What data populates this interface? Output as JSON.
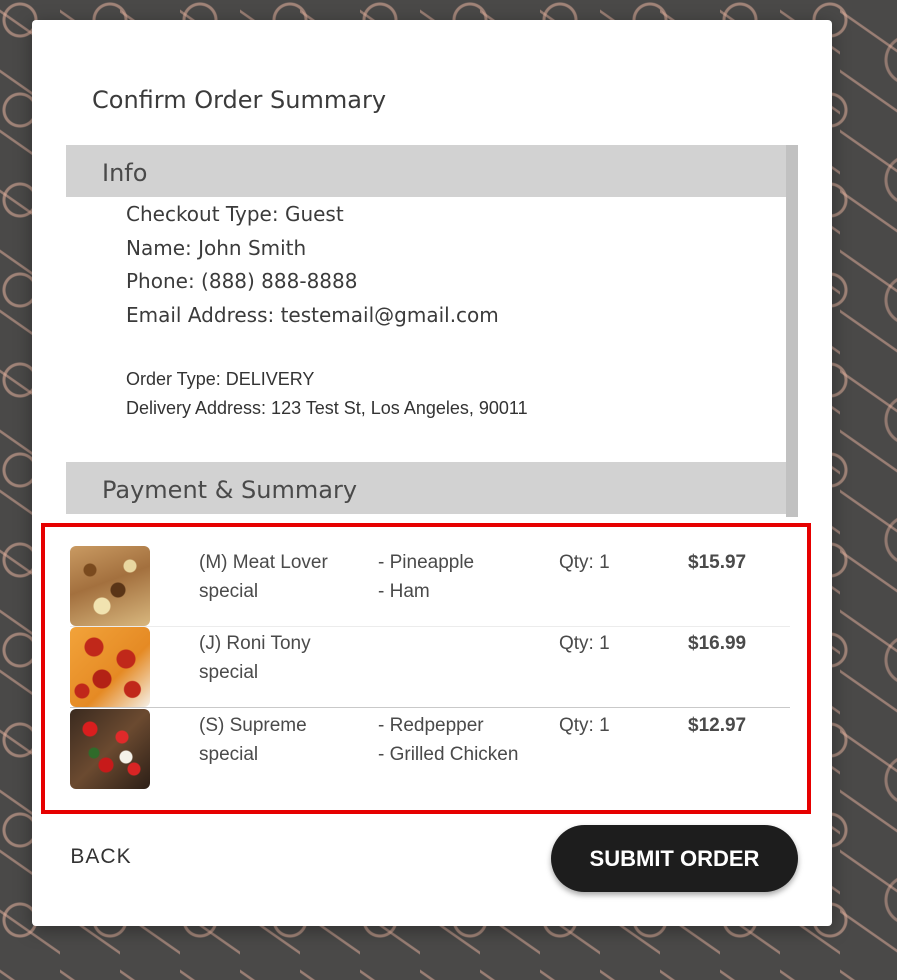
{
  "dialog": {
    "title": "Confirm Order Summary"
  },
  "info": {
    "header": "Info",
    "checkout_type": "Checkout Type: Guest",
    "name": "Name: John Smith",
    "phone": "Phone: (888) 888-8888",
    "email": "Email Address: testemail@gmail.com",
    "order_type": "Order Type: DELIVERY",
    "delivery_address": "Delivery Address: 123 Test St, Los Angeles, 90011"
  },
  "payment": {
    "header": "Payment & Summary"
  },
  "items": [
    {
      "image": "meat-lover-pizza-photo",
      "name": "(M) Meat Lover special",
      "toppings": [
        "- Pineapple",
        "- Ham"
      ],
      "qty": "Qty: 1",
      "price": "$15.97"
    },
    {
      "image": "pepperoni-pizza-photo",
      "name": "(J) Roni Tony special",
      "toppings": [],
      "qty": "Qty: 1",
      "price": "$16.99"
    },
    {
      "image": "supreme-pizza-photo",
      "name": "(S) Supreme special",
      "toppings": [
        "- Redpepper",
        "- Grilled Chicken"
      ],
      "qty": "Qty: 1",
      "price": "$12.97"
    }
  ],
  "actions": {
    "back_label": "BACK",
    "submit_label": "SUBMIT ORDER"
  },
  "colors": {
    "highlight_border": "#e60000",
    "submit_bg": "#1d1d1d",
    "section_header_bg": "#d2d2d2"
  }
}
